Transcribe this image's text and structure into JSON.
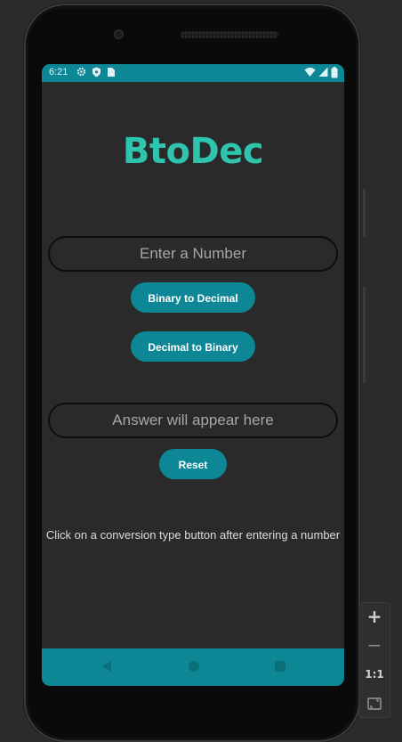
{
  "status_bar": {
    "time": "6:21",
    "left_icons": [
      "settings-icon",
      "shield-icon",
      "sim-card-icon"
    ],
    "right_icons": [
      "wifi-icon",
      "signal-icon",
      "battery-icon"
    ],
    "color": "#0d8796"
  },
  "app": {
    "title": "BtoDec",
    "title_color": "#2fc4ad",
    "accent": "#0d8796",
    "background": "#2a2a2a"
  },
  "input": {
    "placeholder": "Enter a Number",
    "value": ""
  },
  "buttons": {
    "binary_to_decimal": "Binary to Decimal",
    "decimal_to_binary": "Decimal to Binary",
    "reset": "Reset"
  },
  "answer": {
    "placeholder": "Answer will appear here",
    "value": ""
  },
  "hint": "Click on a conversion type button after entering a number",
  "nav_bar": {
    "buttons": [
      "back-icon",
      "home-icon",
      "recents-icon"
    ]
  },
  "emulator_toolbar": {
    "zoom_in": "+",
    "zoom_out": "−",
    "actual_size": "1:1",
    "fit_icon": "fit-screen-icon"
  }
}
